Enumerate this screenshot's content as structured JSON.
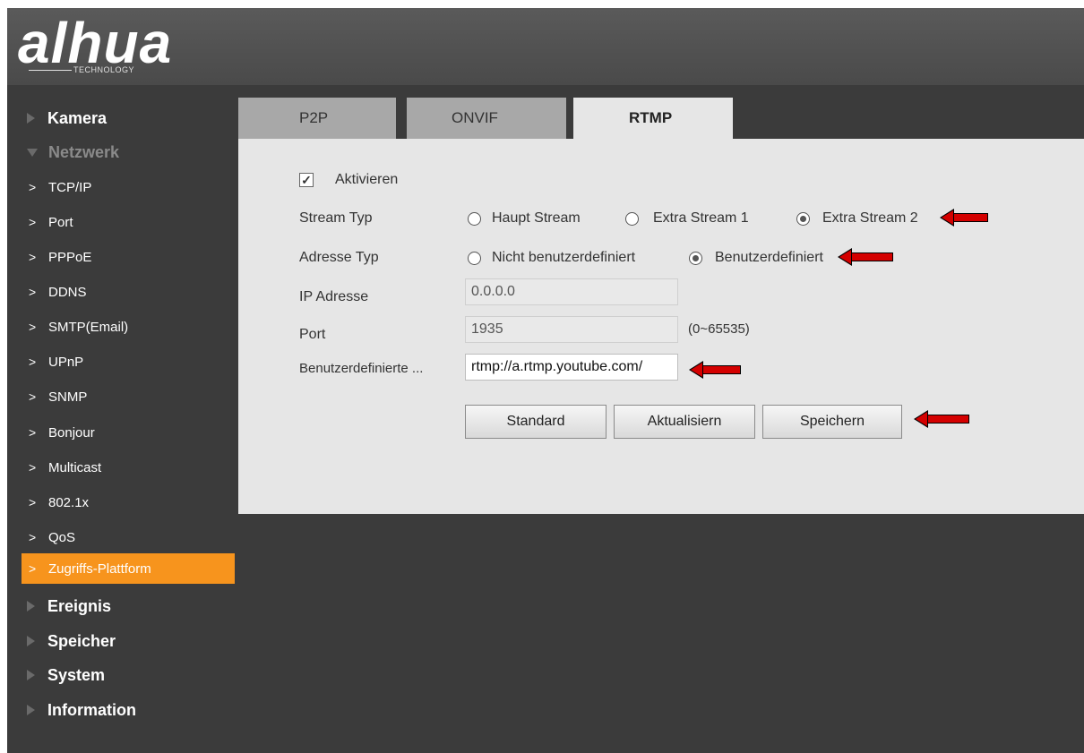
{
  "brand": {
    "name": "alhua",
    "sub": "TECHNOLOGY"
  },
  "sidebar": {
    "main_top": [
      {
        "label": "Kamera",
        "open": false
      },
      {
        "label": "Netzwerk",
        "open": true
      }
    ],
    "sub_items": [
      "TCP/IP",
      "Port",
      "PPPoE",
      "DDNS",
      "SMTP(Email)",
      "UPnP",
      "SNMP",
      "Bonjour",
      "Multicast",
      "802.1x",
      "QoS",
      "Zugriffs-Plattform"
    ],
    "active_sub": "Zugriffs-Plattform",
    "main_bottom": [
      "Ereignis",
      "Speicher",
      "System",
      "Information"
    ]
  },
  "tabs": [
    {
      "label": "P2P",
      "active": false
    },
    {
      "label": "ONVIF",
      "active": false
    },
    {
      "label": "RTMP",
      "active": true
    }
  ],
  "form": {
    "enable": {
      "label": "Aktivieren",
      "checked": true
    },
    "stream_type": {
      "label": "Stream Typ",
      "options": [
        "Haupt Stream",
        "Extra Stream 1",
        "Extra Stream 2"
      ],
      "selected": "Extra Stream 2"
    },
    "address_type": {
      "label": "Adresse Typ",
      "options": [
        "Nicht benutzerdefiniert",
        "Benutzerdefiniert"
      ],
      "selected": "Benutzerdefiniert"
    },
    "ip": {
      "label": "IP Adresse",
      "value": "0.0.0.0"
    },
    "port": {
      "label": "Port",
      "value": "1935",
      "range": "(0~65535)"
    },
    "custom": {
      "label": "Benutzerdefinierte ...",
      "value": "rtmp://a.rtmp.youtube.com/"
    },
    "buttons": {
      "default": "Standard",
      "refresh": "Aktualisiern",
      "save": "Speichern"
    }
  },
  "colors": {
    "accent": "#f7941d",
    "arrow": "#d40000",
    "panel": "#e6e6e6",
    "background": "#3b3b3b"
  }
}
